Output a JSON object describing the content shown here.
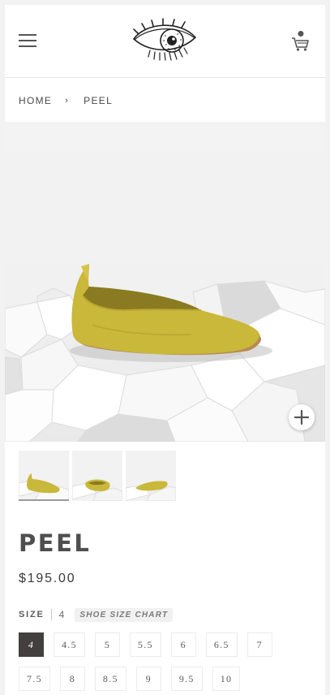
{
  "header": {
    "menu_icon": "hamburger-menu-icon",
    "logo_icon": "eye-logo-icon",
    "cart_icon": "shopping-cart-icon"
  },
  "breadcrumb": {
    "home": "HOME",
    "separator": "›",
    "current": "PEEL"
  },
  "gallery": {
    "zoom_icon": "plus-icon",
    "thumbnail_count": 3
  },
  "product": {
    "title": "PEEL",
    "price": "$195.00",
    "accent_color": "#c9b83a"
  },
  "size": {
    "label": "SIZE",
    "selected": "4",
    "chart_link": "SHOE SIZE CHART",
    "options": [
      "4",
      "4.5",
      "5",
      "5.5",
      "6",
      "6.5",
      "7",
      "7.5",
      "8",
      "8.5",
      "9",
      "9.5",
      "10"
    ]
  }
}
